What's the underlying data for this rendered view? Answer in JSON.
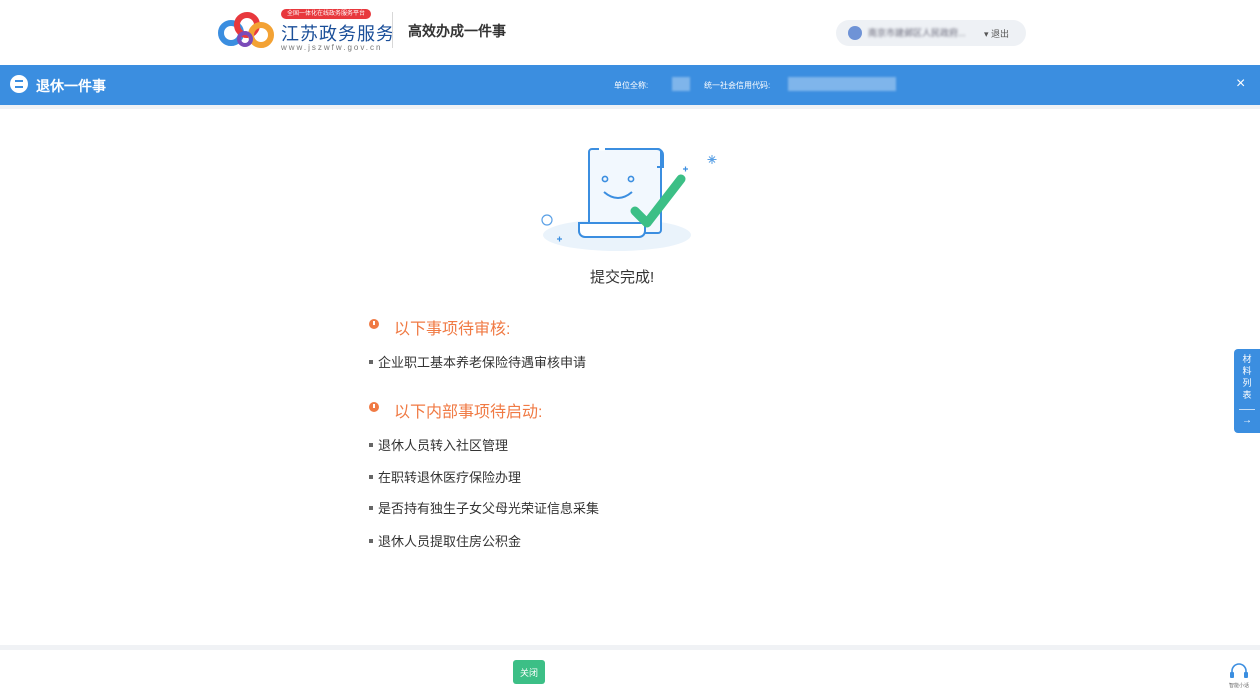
{
  "header": {
    "logo_badge": "全国一体化在线政务服务平台",
    "logo_title": "江苏政务服务",
    "logo_url": "www.jszwfw.gov.cn",
    "subtitle": "高效办成一件事",
    "user_name": "南京市建邺区人民政府...",
    "logout_label": "▾ 退出"
  },
  "bar": {
    "title": "退休一件事",
    "unit_label": "单位全称:",
    "credit_label": "统一社会信用代码:",
    "close_symbol": "×"
  },
  "result": {
    "message": "提交完成!",
    "pending_review_title": "以下事项待审核:",
    "pending_review_items": [
      "企业职工基本养老保险待遇审核申请"
    ],
    "pending_start_title": "以下内部事项待启动:",
    "pending_start_items": [
      "退休人员转入社区管理",
      "在职转退休医疗保险办理",
      "是否持有独生子女父母光荣证信息采集",
      "退休人员提取住房公积金"
    ]
  },
  "side_tab": {
    "label": "材料列表",
    "arrow": "→"
  },
  "footer": {
    "close_label": "关闭",
    "service_label": "智能小话"
  },
  "colors": {
    "brand_blue": "#3b8ee0",
    "accent_orange": "#f07a44",
    "button_green": "#3cbf86"
  },
  "icons": [
    "logo-icon",
    "user-icon",
    "list-icon",
    "close-icon",
    "document-check-icon",
    "warning-icon",
    "arrow-right-icon",
    "headset-icon"
  ]
}
